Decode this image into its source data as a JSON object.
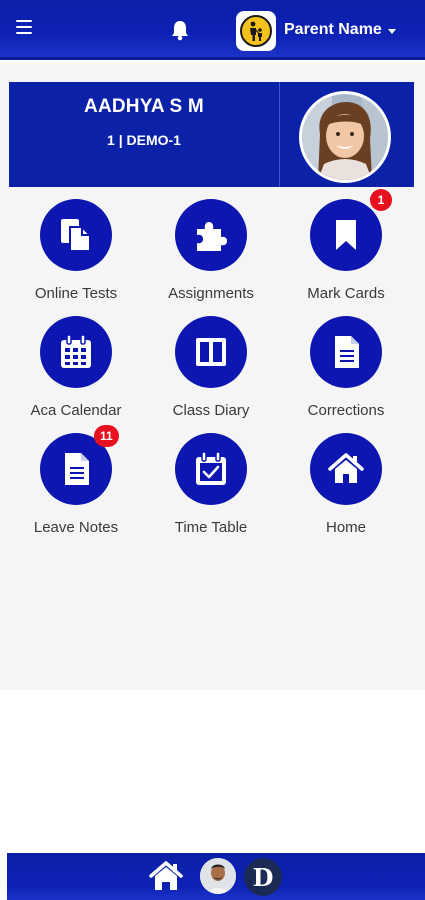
{
  "header": {
    "user_name": "Parent Name",
    "menu_icon": "hamburger-icon",
    "notification_icon": "bell-icon",
    "logo_icon": "parent-child-logo"
  },
  "student": {
    "name": "AADHYA S M",
    "class": "1 | DEMO-1"
  },
  "tiles": [
    {
      "label": "Online Tests",
      "icon": "documents-icon"
    },
    {
      "label": "Assignments",
      "icon": "puzzle-icon"
    },
    {
      "label": "Mark Cards",
      "icon": "bookmark-icon",
      "badge": "1"
    },
    {
      "label": "Aca Calendar",
      "icon": "calendar-icon"
    },
    {
      "label": "Class Diary",
      "icon": "book-columns-icon"
    },
    {
      "label": "Corrections",
      "icon": "document-lines-icon"
    },
    {
      "label": "Leave Notes",
      "icon": "note-icon",
      "badge": "11"
    },
    {
      "label": "Time Table",
      "icon": "calendar-check-icon"
    },
    {
      "label": "Home",
      "icon": "home-icon"
    }
  ],
  "bottom_nav": {
    "items": [
      "home-icon",
      "profile-avatar",
      "d-logo"
    ],
    "d_logo_text": "D"
  },
  "colors": {
    "primary": "#0d16b0",
    "header": "#0b1fa8",
    "badge": "#e8101e",
    "background": "#f5f5f5"
  }
}
